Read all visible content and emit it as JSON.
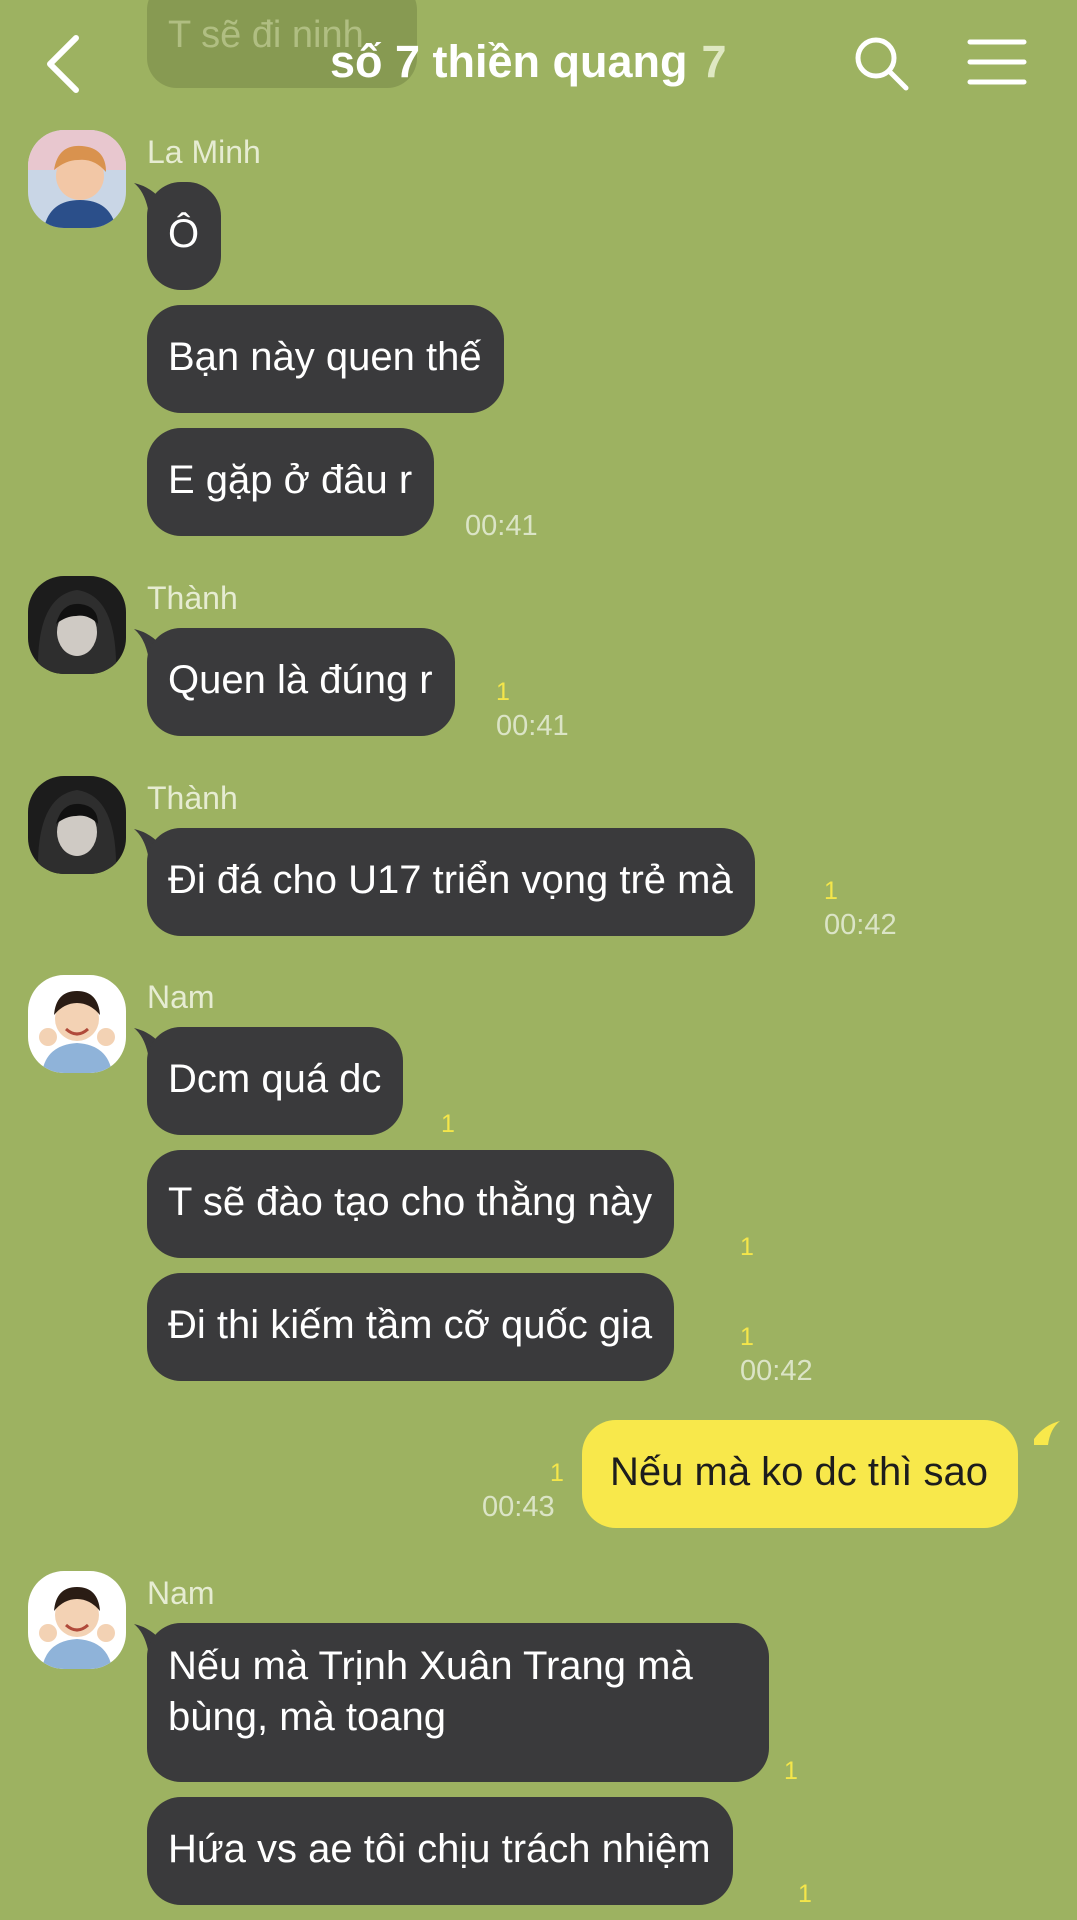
{
  "header": {
    "title": "số 7 thiền quang",
    "member_count": "7",
    "ghost_message": "T sẽ đi ninh"
  },
  "icons": {
    "back": "chevron-left-icon",
    "search": "search-icon",
    "menu": "hamburger-menu-icon"
  },
  "colors": {
    "chat_background": "#9db261",
    "incoming_bubble": "#3a3a3c",
    "outgoing_bubble": "#f8e84b",
    "unread_count": "#f4e64a"
  },
  "messages": {
    "g1": {
      "sender": "La Minh",
      "b1": "Ô",
      "b2": "Bạn này quen thế",
      "b3": "E gặp ở đâu r",
      "time": "00:41"
    },
    "g2": {
      "sender": "Thành",
      "b1": "Quen là đúng r",
      "unread": "1",
      "time": "00:41"
    },
    "g3": {
      "sender": "Thành",
      "b1": "Đi đá cho U17 triển vọng trẻ mà",
      "unread": "1",
      "time": "00:42"
    },
    "g4": {
      "sender": "Nam",
      "b1": "Dcm quá dc",
      "b1_unread": "1",
      "b2": "T sẽ đào tạo cho thằng này",
      "b2_unread": "1",
      "b3": "Đi thi kiếm tầm cỡ quốc gia",
      "b3_unread": "1",
      "time": "00:42"
    },
    "mine": {
      "text": "Nếu mà ko dc thì sao",
      "unread": "1",
      "time": "00:43"
    },
    "g5": {
      "sender": "Nam",
      "b1": "Nếu mà Trịnh Xuân Trang mà bùng, mà toang",
      "b1_unread": "1",
      "b2": "Hứa vs ae tôi chịu trách nhiệm",
      "b2_unread": "1"
    }
  }
}
